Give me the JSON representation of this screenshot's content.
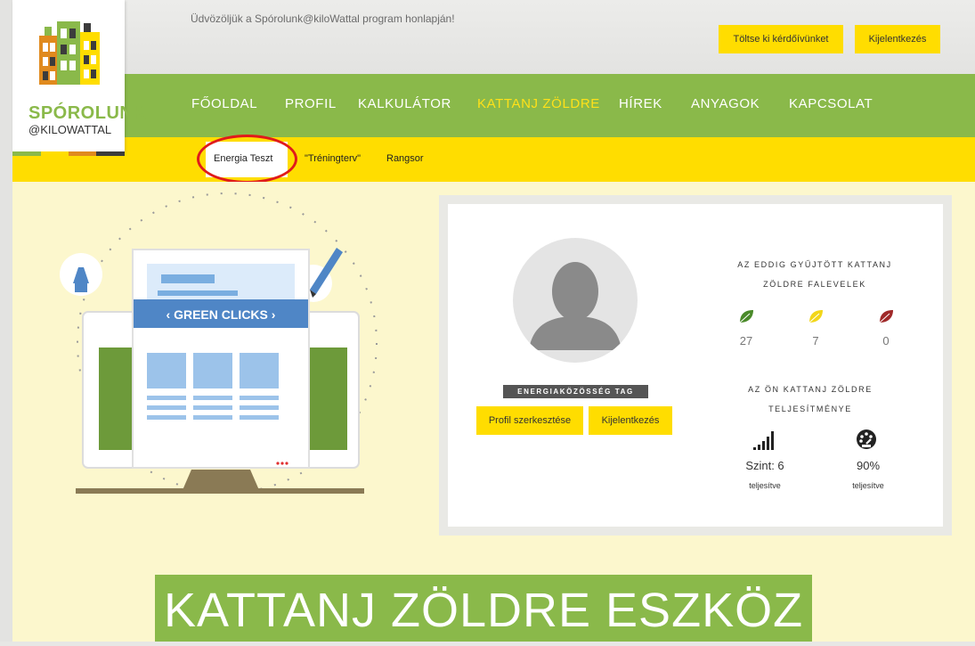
{
  "header": {
    "welcome_text": "Üdvözöljük a Spórolunk@kiloWattal program honlapján!",
    "survey_button": "Töltse ki kérdőívünket",
    "logout_button": "Kijelentkezés"
  },
  "logo": {
    "line1": "SPÓROLUNK",
    "line2": "@KILOWATTAL"
  },
  "nav": {
    "items": [
      "FŐOLDAL",
      "PROFIL",
      "KALKULÁTOR",
      "KATTANJ ZÖLDRE",
      "HÍREK",
      "ANYAGOK",
      "KAPCSOLAT"
    ],
    "active": "KATTANJ ZÖLDRE"
  },
  "subnav": {
    "items": [
      "Energia Teszt",
      "\"Tréningterv\"",
      "Rangsor"
    ],
    "active": "Energia Teszt"
  },
  "illustration": {
    "banner_text": "‹  GREEN CLICKS  ›"
  },
  "profile": {
    "badge": "ENERGIAKÖZÖSSÉG TAG",
    "edit_button": "Profil szerkesztése",
    "logout_button": "Kijelentkezés"
  },
  "leaves": {
    "caption_line1": "AZ EDDIG GYŰJTÖTT KATTANJ",
    "caption_line2": "ZÖLDRE FALEVELEK",
    "green": "27",
    "yellow": "7",
    "red": "0",
    "colors": {
      "green": "#4a8a2a",
      "yellow": "#f2d61a",
      "red": "#a02a2a"
    }
  },
  "performance": {
    "caption_line1": "AZ ÖN KATTANJ ZÖLDRE",
    "caption_line2": "TELJESÍTMÉNYE",
    "level": "Szint: 6",
    "level_sub": "teljesítve",
    "percent": "90%",
    "percent_sub": "teljesítve"
  },
  "page_title": "KATTANJ ZÖLDRE ESZKÖZ"
}
